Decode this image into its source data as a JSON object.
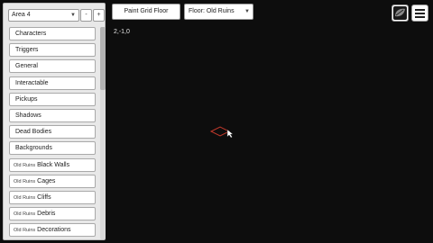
{
  "sidebar": {
    "area_select": "Area 4",
    "buttons": [
      "-",
      "+"
    ],
    "items": [
      {
        "prefix": "",
        "label": "Characters"
      },
      {
        "prefix": "",
        "label": "Triggers"
      },
      {
        "prefix": "",
        "label": "General"
      },
      {
        "prefix": "",
        "label": "Interactable"
      },
      {
        "prefix": "",
        "label": "Pickups"
      },
      {
        "prefix": "",
        "label": "Shadows"
      },
      {
        "prefix": "",
        "label": "Dead Bodies"
      },
      {
        "prefix": "",
        "label": "Backgrounds"
      },
      {
        "prefix": "Old Ruins",
        "label": "Black Walls"
      },
      {
        "prefix": "Old Ruins",
        "label": "Cages"
      },
      {
        "prefix": "Old Ruins",
        "label": "Cliffs"
      },
      {
        "prefix": "Old Ruins",
        "label": "Debris"
      },
      {
        "prefix": "Old Ruins",
        "label": "Decorations"
      }
    ]
  },
  "toolbar": {
    "paint_grid_floor": "Paint Grid Floor",
    "floor_select": "Floor: Old Ruins"
  },
  "canvas": {
    "coordinates": "2,-1,0"
  },
  "icons": {
    "leaf": "leaf-icon",
    "menu": "hamburger-menu-icon"
  },
  "colors": {
    "canvas_bg": "#0d0d0d",
    "cursor_outline": "#c0392b"
  }
}
